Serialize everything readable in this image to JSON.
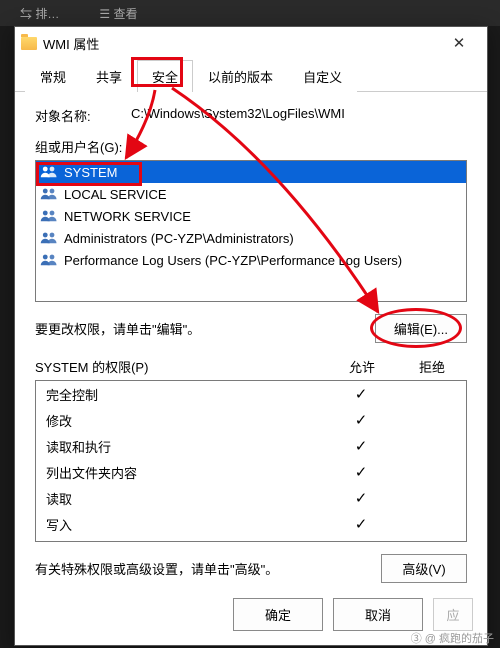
{
  "bg_toolbar": [
    "排…",
    "查看"
  ],
  "titlebar": {
    "title": "WMI 属性",
    "close": "✕"
  },
  "tabs": {
    "items": [
      "常规",
      "共享",
      "安全",
      "以前的版本",
      "自定义"
    ],
    "active_index": 2
  },
  "object": {
    "label": "对象名称:",
    "path": "C:\\Windows\\System32\\LogFiles\\WMI"
  },
  "groups": {
    "label": "组或用户名(G):",
    "items": [
      {
        "name": "SYSTEM",
        "selected": true
      },
      {
        "name": "LOCAL SERVICE",
        "selected": false
      },
      {
        "name": "NETWORK SERVICE",
        "selected": false
      },
      {
        "name": "Administrators (PC-YZP\\Administrators)",
        "selected": false
      },
      {
        "name": "Performance Log Users (PC-YZP\\Performance Log Users)",
        "selected": false
      }
    ]
  },
  "edit": {
    "hint": "要更改权限，请单击\"编辑\"。",
    "button": "编辑(E)..."
  },
  "perm_title": "SYSTEM 的权限(P)",
  "perm_cols": {
    "allow": "允许",
    "deny": "拒绝"
  },
  "perms": [
    {
      "name": "完全控制",
      "allow": true,
      "deny": false
    },
    {
      "name": "修改",
      "allow": true,
      "deny": false
    },
    {
      "name": "读取和执行",
      "allow": true,
      "deny": false
    },
    {
      "name": "列出文件夹内容",
      "allow": true,
      "deny": false
    },
    {
      "name": "读取",
      "allow": true,
      "deny": false
    },
    {
      "name": "写入",
      "allow": true,
      "deny": false
    }
  ],
  "advanced": {
    "hint": "有关特殊权限或高级设置，请单击\"高级\"。",
    "button": "高级(V)"
  },
  "footer": {
    "ok": "确定",
    "cancel": "取消",
    "apply": "应"
  },
  "watermark": "③ @ 疯跑的茄子",
  "colors": {
    "selection": "#0a64d8",
    "annotation": "#e30613"
  }
}
